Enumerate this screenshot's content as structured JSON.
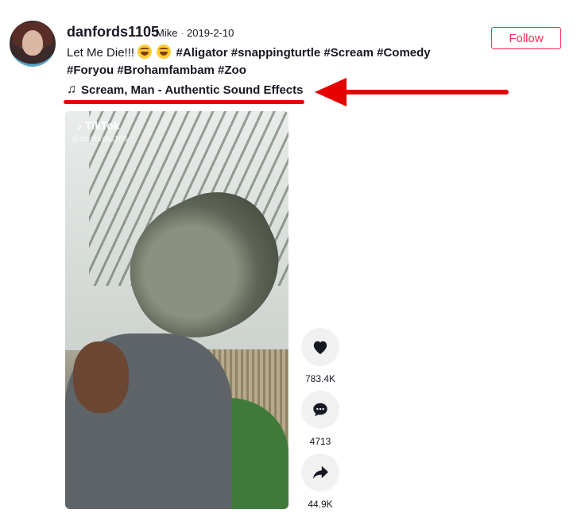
{
  "post": {
    "username": "danfords1105",
    "author_name": "Mike",
    "separator": "·",
    "date": "2019-2-10",
    "caption_text": "Let Me Die!!! ",
    "hashtags_line1": "#Aligator #snappingturtle #Scream #Comedy",
    "hashtags_line2": "#Foryou #Brohamfambam #Zoo",
    "music_note": "♫",
    "music": "Scream, Man - Authentic Sound Effects"
  },
  "follow_button": {
    "label": "Follow"
  },
  "video": {
    "watermark": "TikTok",
    "watermark_handle": "@danfords1105"
  },
  "actions": {
    "likes": "783.4K",
    "comments": "4713",
    "shares": "44.9K"
  },
  "annotation": {
    "color": "#e60000"
  },
  "colors": {
    "accent": "#fe2c55",
    "text": "#161823"
  }
}
